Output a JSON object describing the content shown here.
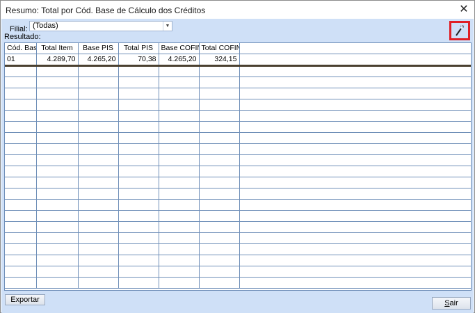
{
  "window": {
    "title": "Resumo: Total por Cód. Base de Cálculo dos Créditos",
    "close_glyph": "✕"
  },
  "filter": {
    "label": "Filial:",
    "selected": "(Todas)",
    "arrow_glyph": "▼"
  },
  "result_label": "Resultado:",
  "grid": {
    "columns": [
      "Cód. Base",
      "Total Item",
      "Base PIS",
      "Total PIS",
      "Base COFINS",
      "Total COFINS",
      ""
    ],
    "rows": [
      [
        "01",
        "4.289,70",
        "4.265,20",
        "70,38",
        "4.265,20",
        "324,15",
        ""
      ]
    ]
  },
  "buttons": {
    "export": "Exportar",
    "exit_first": "S",
    "exit_rest": "air"
  },
  "icons": {
    "wand": "magic-wand-icon"
  },
  "colors": {
    "panel_bg": "#cfe0f7",
    "grid_line": "#6f8fb8",
    "highlight_border": "#e01f25"
  }
}
